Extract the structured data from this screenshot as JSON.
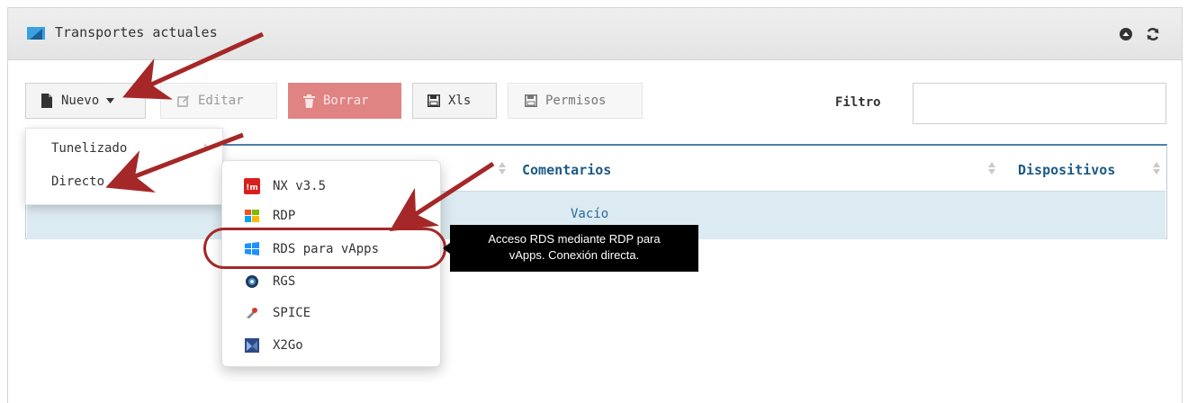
{
  "panel": {
    "title": "Transportes actuales",
    "header_icons": [
      "collapse-icon",
      "refresh-icon"
    ]
  },
  "toolbar": {
    "new_label": "Nuevo",
    "edit_label": "Editar",
    "delete_label": "Borrar",
    "xls_label": "Xls",
    "permissions_label": "Permisos",
    "filter_label": "Filtro",
    "filter_value": ""
  },
  "new_menu": {
    "items": [
      {
        "label": "Tunelizado",
        "has_submenu": true
      },
      {
        "label": "Directo",
        "has_submenu": false
      }
    ]
  },
  "submenu": {
    "items": [
      {
        "label": "NX v3.5",
        "icon": "nx-icon"
      },
      {
        "label": "RDP",
        "icon": "windows-icon"
      },
      {
        "label": "RDS para vApps",
        "icon": "windows-blue-icon",
        "highlighted": true
      },
      {
        "label": "RGS",
        "icon": "rgs-icon"
      },
      {
        "label": "SPICE",
        "icon": "spice-icon"
      },
      {
        "label": "X2Go",
        "icon": "x2go-icon"
      }
    ]
  },
  "tooltip": {
    "line1": "Acceso RDS mediante RDP para",
    "line2": "vApps. Conexión directa."
  },
  "table": {
    "columns": [
      "Comentarios",
      "Dispositivos"
    ],
    "empty_text": "Vacío"
  },
  "colors": {
    "header_text": "#1d5a86",
    "danger_button": "#e08383",
    "annotation": "#a52727",
    "row_band": "#dceaf1"
  }
}
